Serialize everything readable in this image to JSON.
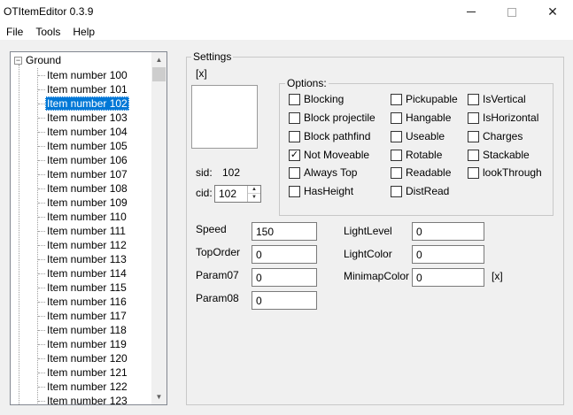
{
  "window": {
    "title": "OTItemEditor 0.3.9"
  },
  "menu": [
    "File",
    "Tools",
    "Help"
  ],
  "tree": {
    "root_label": "Ground",
    "expander": "−",
    "items": [
      "Item number 100",
      "Item number 101",
      "Item number 102",
      "Item number 103",
      "Item number 104",
      "Item number 105",
      "Item number 106",
      "Item number 107",
      "Item number 108",
      "Item number 109",
      "Item number 110",
      "Item number 111",
      "Item number 112",
      "Item number 113",
      "Item number 114",
      "Item number 115",
      "Item number 116",
      "Item number 117",
      "Item number 118",
      "Item number 119",
      "Item number 120",
      "Item number 121",
      "Item number 122",
      "Item number 123"
    ],
    "selected_index": 2
  },
  "settings": {
    "legend": "Settings",
    "preview_toggle": "[x]",
    "sid_label": "sid:",
    "sid_value": "102",
    "cid_label": "cid:",
    "cid_value": "102"
  },
  "options": {
    "legend": "Options:",
    "items": [
      {
        "label": "Blocking",
        "checked": false
      },
      {
        "label": "Block projectile",
        "checked": false
      },
      {
        "label": "Block pathfind",
        "checked": false
      },
      {
        "label": "Not Moveable",
        "checked": true
      },
      {
        "label": "Always Top",
        "checked": false
      },
      {
        "label": "HasHeight",
        "checked": false
      },
      {
        "label": "Pickupable",
        "checked": false
      },
      {
        "label": "Hangable",
        "checked": false
      },
      {
        "label": "Useable",
        "checked": false
      },
      {
        "label": "Rotable",
        "checked": false
      },
      {
        "label": "Readable",
        "checked": false
      },
      {
        "label": "DistRead",
        "checked": false
      },
      {
        "label": "IsVertical",
        "checked": false
      },
      {
        "label": "IsHorizontal",
        "checked": false
      },
      {
        "label": "Charges",
        "checked": false
      },
      {
        "label": "Stackable",
        "checked": false
      },
      {
        "label": "lookThrough",
        "checked": false
      }
    ]
  },
  "fields": {
    "speed": {
      "label": "Speed",
      "value": "150"
    },
    "toporder": {
      "label": "TopOrder",
      "value": "0"
    },
    "param07": {
      "label": "Param07",
      "value": "0"
    },
    "param08": {
      "label": "Param08",
      "value": "0"
    },
    "lightlevel": {
      "label": "LightLevel",
      "value": "0"
    },
    "lightcolor": {
      "label": "LightColor",
      "value": "0"
    },
    "minimapcolor": {
      "label": "MinimapColor",
      "value": "0"
    },
    "minimap_toggle": "[x]"
  }
}
